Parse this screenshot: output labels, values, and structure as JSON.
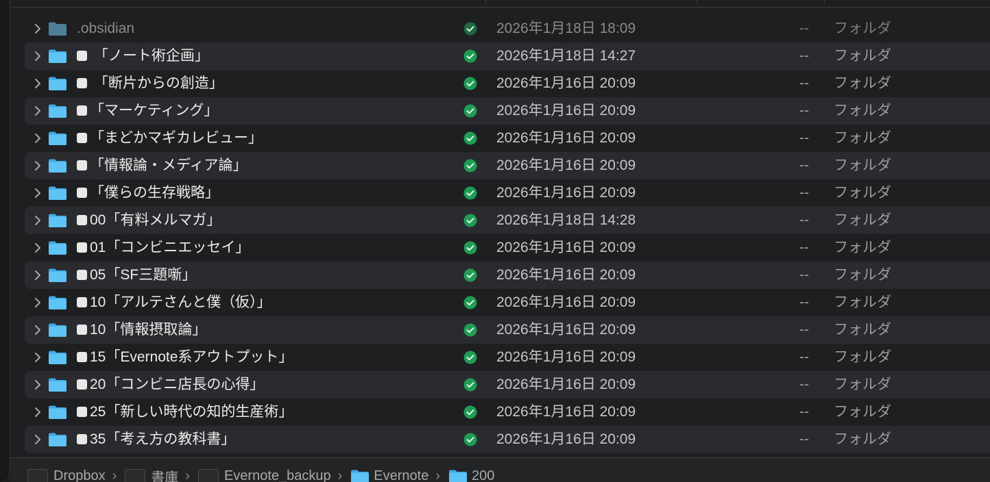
{
  "rows": [
    {
      "name": ".obsidian",
      "prefix": false,
      "date": "2026年1月18日 18:09",
      "size": "--",
      "kind": "フォルダ"
    },
    {
      "name": " 「ノート術企画」",
      "prefix": true,
      "date": "2026年1月18日 14:27",
      "size": "--",
      "kind": "フォルダ"
    },
    {
      "name": " 「断片からの創造」",
      "prefix": true,
      "date": "2026年1月16日 20:09",
      "size": "--",
      "kind": "フォルダ"
    },
    {
      "name": "「マーケティング」",
      "prefix": true,
      "date": "2026年1月16日 20:09",
      "size": "--",
      "kind": "フォルダ"
    },
    {
      "name": "「まどかマギカレビュー」",
      "prefix": true,
      "date": "2026年1月16日 20:09",
      "size": "--",
      "kind": "フォルダ"
    },
    {
      "name": "「情報論・メディア論」",
      "prefix": true,
      "date": "2026年1月16日 20:09",
      "size": "--",
      "kind": "フォルダ"
    },
    {
      "name": "「僕らの生存戦略」",
      "prefix": true,
      "date": "2026年1月16日 20:09",
      "size": "--",
      "kind": "フォルダ"
    },
    {
      "name": "00「有料メルマガ」",
      "prefix": true,
      "date": "2026年1月18日 14:28",
      "size": "--",
      "kind": "フォルダ"
    },
    {
      "name": "01「コンビニエッセイ」",
      "prefix": true,
      "date": "2026年1月16日 20:09",
      "size": "--",
      "kind": "フォルダ"
    },
    {
      "name": "05「SF三題噺」",
      "prefix": true,
      "date": "2026年1月16日 20:09",
      "size": "--",
      "kind": "フォルダ"
    },
    {
      "name": "10「アルテさんと僕（仮）」",
      "prefix": true,
      "date": "2026年1月16日 20:09",
      "size": "--",
      "kind": "フォルダ"
    },
    {
      "name": "10「情報摂取論」",
      "prefix": true,
      "date": "2026年1月16日 20:09",
      "size": "--",
      "kind": "フォルダ"
    },
    {
      "name": "15「Evernote系アウトプット」",
      "prefix": true,
      "date": "2026年1月16日 20:09",
      "size": "--",
      "kind": "フォルダ"
    },
    {
      "name": "20「コンビニ店長の心得」",
      "prefix": true,
      "date": "2026年1月16日 20:09",
      "size": "--",
      "kind": "フォルダ"
    },
    {
      "name": "25「新しい時代の知的生産術」",
      "prefix": true,
      "date": "2026年1月16日 20:09",
      "size": "--",
      "kind": "フォルダ"
    },
    {
      "name": "35「考え方の教科書」",
      "prefix": true,
      "date": "2026年1月16日 20:09",
      "size": "--",
      "kind": "フォルダ"
    }
  ],
  "pathbar": {
    "crumbs": [
      {
        "label": "Dropbox",
        "icon": "app-icon"
      },
      {
        "label": "書庫",
        "icon": "app-icon"
      },
      {
        "label": "Evernote_backup",
        "icon": "app-icon"
      },
      {
        "label": "Evernote",
        "icon": "folder-icon"
      },
      {
        "label": "200",
        "icon": "folder-icon"
      }
    ],
    "separator": "›"
  },
  "colors": {
    "folder": "#5ec3f5",
    "sync_ok": "#1f9d55",
    "row_alt": "#2a2b2e"
  }
}
